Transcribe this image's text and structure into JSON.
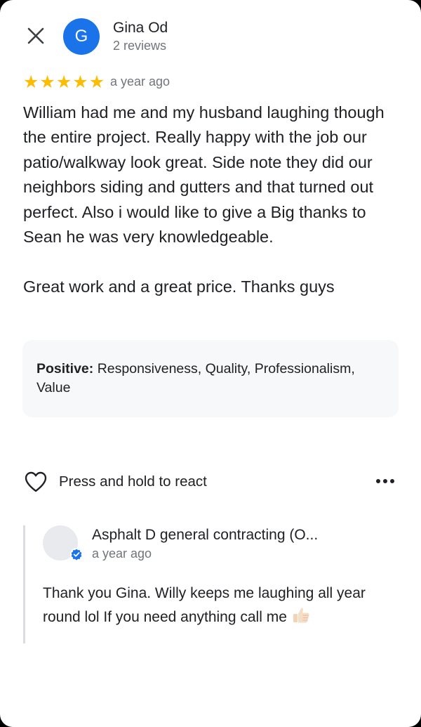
{
  "header": {
    "close_icon": "close-icon",
    "avatar_letter": "G",
    "avatar_color": "#1a73e8",
    "reviewer_name": "Gina Od",
    "reviewer_reviews": "2 reviews"
  },
  "review": {
    "rating": 5,
    "max_rating": 5,
    "star_color": "#fbbc04",
    "time": "a year ago",
    "text": "William had me and my husband laughing though the entire project. Really happy with the job our patio/walkway look great.  Side note they did our neighbors siding and gutters and that turned out perfect.  Also i would like to give a Big thanks to Sean he was very knowledgeable.\n\nGreat work and a great price.    Thanks guys"
  },
  "attributes": {
    "label": "Positive:",
    "value": " Responsiveness, Quality, Professionalism, Value"
  },
  "actions": {
    "react_icon": "heart-outline-icon",
    "react_label": "Press and hold to react",
    "more_icon": "more-horizontal-icon"
  },
  "owner_response": {
    "name": "Asphalt D general contracting (O...",
    "time": "a year ago",
    "verified_icon": "verified-badge-icon",
    "text": "Thank you Gina. Willy keeps me laughing all year round lol If you need anything call me",
    "emoji_icon": "thumbs-up-emoji-icon"
  }
}
